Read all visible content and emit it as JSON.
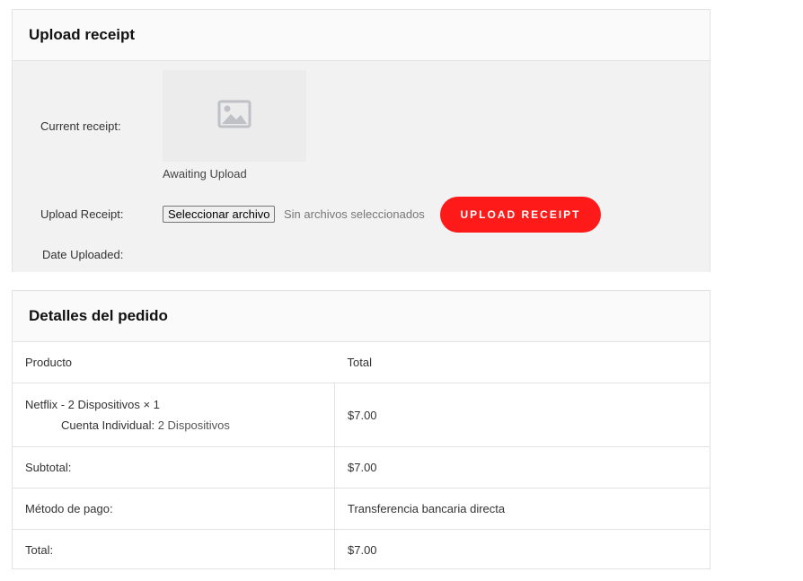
{
  "upload": {
    "title": "Upload receipt",
    "current_label": "Current receipt:",
    "image_icon": "image-placeholder-icon",
    "awaiting": "Awaiting Upload",
    "upload_label": "Upload Receipt:",
    "file_button": "Seleccionar archivo",
    "file_status": "Sin archivos seleccionados",
    "submit_label": "UPLOAD RECEIPT",
    "date_label": "Date Uploaded:",
    "accent_color": "#ff1a1a"
  },
  "order": {
    "title": "Detalles del pedido",
    "headers": [
      "Producto",
      "Total"
    ],
    "item": {
      "name": "Netflix - 2 Dispositivos × 1",
      "meta_key": "Cuenta Individual:",
      "meta_value": "2 Dispositivos",
      "total": "$7.00"
    },
    "rows": [
      {
        "label": "Subtotal:",
        "value": "$7.00"
      },
      {
        "label": "Método de pago:",
        "value": "Transferencia bancaria directa"
      },
      {
        "label": "Total:",
        "value": "$7.00"
      }
    ]
  }
}
